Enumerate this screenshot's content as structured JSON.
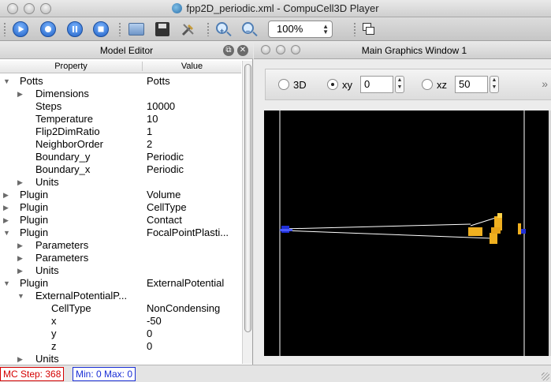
{
  "window": {
    "title": "fpp2D_periodic.xml - CompuCell3D Player"
  },
  "toolbar": {
    "zoom_level": "100%",
    "buttons": [
      "run-icon",
      "step-icon",
      "pause-icon",
      "stop-icon",
      "open-folder-icon",
      "save-icon",
      "tools-icon",
      "zoom-in-icon",
      "zoom-out-icon",
      "windows-icon"
    ]
  },
  "model_editor": {
    "title": "Model Editor",
    "columns": {
      "property": "Property",
      "value": "Value"
    },
    "rows": [
      {
        "expander": "open",
        "indent": 0,
        "property": "Potts",
        "value": "Potts"
      },
      {
        "expander": "closed",
        "indent": 1,
        "property": "Dimensions",
        "value": ""
      },
      {
        "expander": "none",
        "indent": 1,
        "property": "Steps",
        "value": "10000"
      },
      {
        "expander": "none",
        "indent": 1,
        "property": "Temperature",
        "value": "10"
      },
      {
        "expander": "none",
        "indent": 1,
        "property": "Flip2DimRatio",
        "value": "1"
      },
      {
        "expander": "none",
        "indent": 1,
        "property": "NeighborOrder",
        "value": "2"
      },
      {
        "expander": "none",
        "indent": 1,
        "property": "Boundary_y",
        "value": "Periodic"
      },
      {
        "expander": "none",
        "indent": 1,
        "property": "Boundary_x",
        "value": "Periodic"
      },
      {
        "expander": "closed",
        "indent": 1,
        "property": "Units",
        "value": ""
      },
      {
        "expander": "closed",
        "indent": 0,
        "property": "Plugin",
        "value": "Volume"
      },
      {
        "expander": "closed",
        "indent": 0,
        "property": "Plugin",
        "value": "CellType"
      },
      {
        "expander": "closed",
        "indent": 0,
        "property": "Plugin",
        "value": "Contact"
      },
      {
        "expander": "open",
        "indent": 0,
        "property": "Plugin",
        "value": "FocalPointPlasti..."
      },
      {
        "expander": "closed",
        "indent": 1,
        "property": "Parameters",
        "value": ""
      },
      {
        "expander": "closed",
        "indent": 1,
        "property": "Parameters",
        "value": ""
      },
      {
        "expander": "closed",
        "indent": 1,
        "property": "Units",
        "value": ""
      },
      {
        "expander": "open",
        "indent": 0,
        "property": "Plugin",
        "value": "ExternalPotential"
      },
      {
        "expander": "open",
        "indent": 1,
        "property": "ExternalPotentialP...",
        "value": ""
      },
      {
        "expander": "none",
        "indent": 2,
        "property": "CellType",
        "value": "NonCondensing"
      },
      {
        "expander": "none",
        "indent": 2,
        "property": "x",
        "value": "-50"
      },
      {
        "expander": "none",
        "indent": 2,
        "property": "y",
        "value": "0"
      },
      {
        "expander": "none",
        "indent": 2,
        "property": "z",
        "value": "0"
      },
      {
        "expander": "closed",
        "indent": 1,
        "property": "Units",
        "value": ""
      }
    ]
  },
  "graphics_window": {
    "title": "Main Graphics Window 1",
    "projection_3d_label": "3D",
    "projection_xy_label": "xy",
    "projection_xy_value": "0",
    "projection_xz_label": "xz",
    "projection_xz_value": "50",
    "selected_projection": "xy",
    "colors": {
      "background": "#000000",
      "blue_cell": "#2030d8",
      "yellow_cell": "#f0b020",
      "link": "#ffffff"
    }
  },
  "status": {
    "mc_step": "MC Step: 368",
    "min_max": "Min: 0 Max: 0"
  }
}
